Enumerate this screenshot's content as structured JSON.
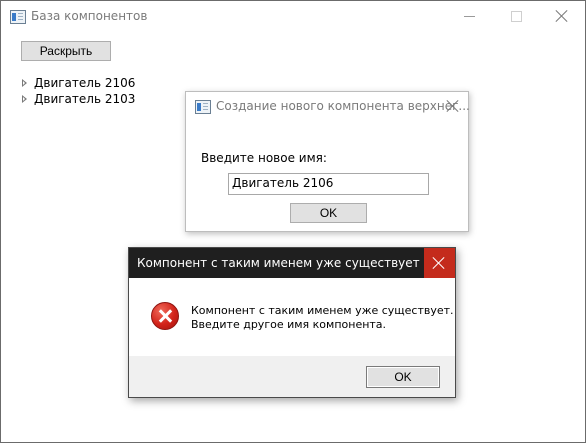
{
  "main_window": {
    "title": "База компонентов",
    "expand_button_label": "Раскрыть",
    "tree": [
      {
        "label": "Двигатель 2106"
      },
      {
        "label": "Двигатель 2103"
      }
    ]
  },
  "create_dialog": {
    "title": "Создание нового компонента верхнег...",
    "prompt": "Введите новое имя:",
    "name_value": "Двигатель 2106",
    "ok_label": "OK"
  },
  "error_dialog": {
    "title": "Компонент с таким именем уже существует",
    "message_line1": "Компонент с таким именем уже существует.",
    "message_line2": "Введите другое имя компонента.",
    "ok_label": "OK",
    "icon": "error-icon",
    "colors": {
      "titlebar": "#1f1f1f",
      "close_hover": "#c42b1c"
    }
  }
}
